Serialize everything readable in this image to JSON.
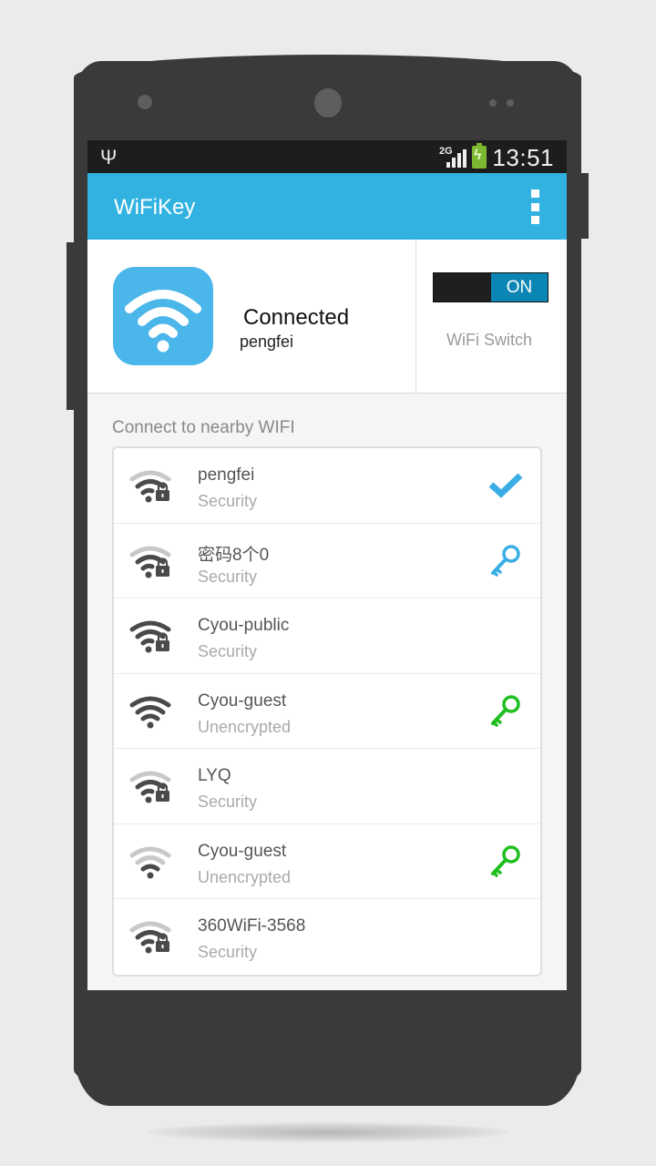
{
  "status_bar": {
    "usb_icon": "usb-icon",
    "network_type": "2G",
    "signal_icon": "cell-signal-icon",
    "battery_icon": "battery-charging-icon",
    "time": "13:51"
  },
  "app_bar": {
    "title": "WiFiKey",
    "menu_icon": "overflow-menu-icon"
  },
  "connection": {
    "status": "Connected",
    "ssid": "pengfei",
    "icon": "wifi-icon"
  },
  "wifi_switch": {
    "state_label": "ON",
    "enabled": true,
    "label": "WiFi Switch"
  },
  "nearby": {
    "title": "Connect to nearby WIFI",
    "networks": [
      {
        "ssid": "pengfei",
        "security": "Security",
        "locked": true,
        "signal_bars": 2,
        "action": "connected-check-icon",
        "action_color": "#3aaee4"
      },
      {
        "ssid": "密码8个0",
        "security": "Security",
        "locked": true,
        "signal_bars": 2,
        "action": "key-icon",
        "action_color": "#3aaee4"
      },
      {
        "ssid": "Cyou-public",
        "security": "Security",
        "locked": true,
        "signal_bars": 3,
        "action": "",
        "action_color": ""
      },
      {
        "ssid": "Cyou-guest",
        "security": "Unencrypted",
        "locked": false,
        "signal_bars": 3,
        "action": "key-icon",
        "action_color": "#1fbf1f"
      },
      {
        "ssid": "LYQ",
        "security": "Security",
        "locked": true,
        "signal_bars": 2,
        "action": "",
        "action_color": ""
      },
      {
        "ssid": "Cyou-guest",
        "security": "Unencrypted",
        "locked": false,
        "signal_bars": 1,
        "action": "key-icon",
        "action_color": "#1fbf1f"
      },
      {
        "ssid": "360WiFi-3568",
        "security": "Security",
        "locked": true,
        "signal_bars": 2,
        "action": "",
        "action_color": ""
      }
    ]
  },
  "colors": {
    "app_bar": "#31b2e1",
    "switch_on": "#0b86b4",
    "wifi_badge": "#4bb6ea",
    "phone_body": "#3a3a3a"
  }
}
